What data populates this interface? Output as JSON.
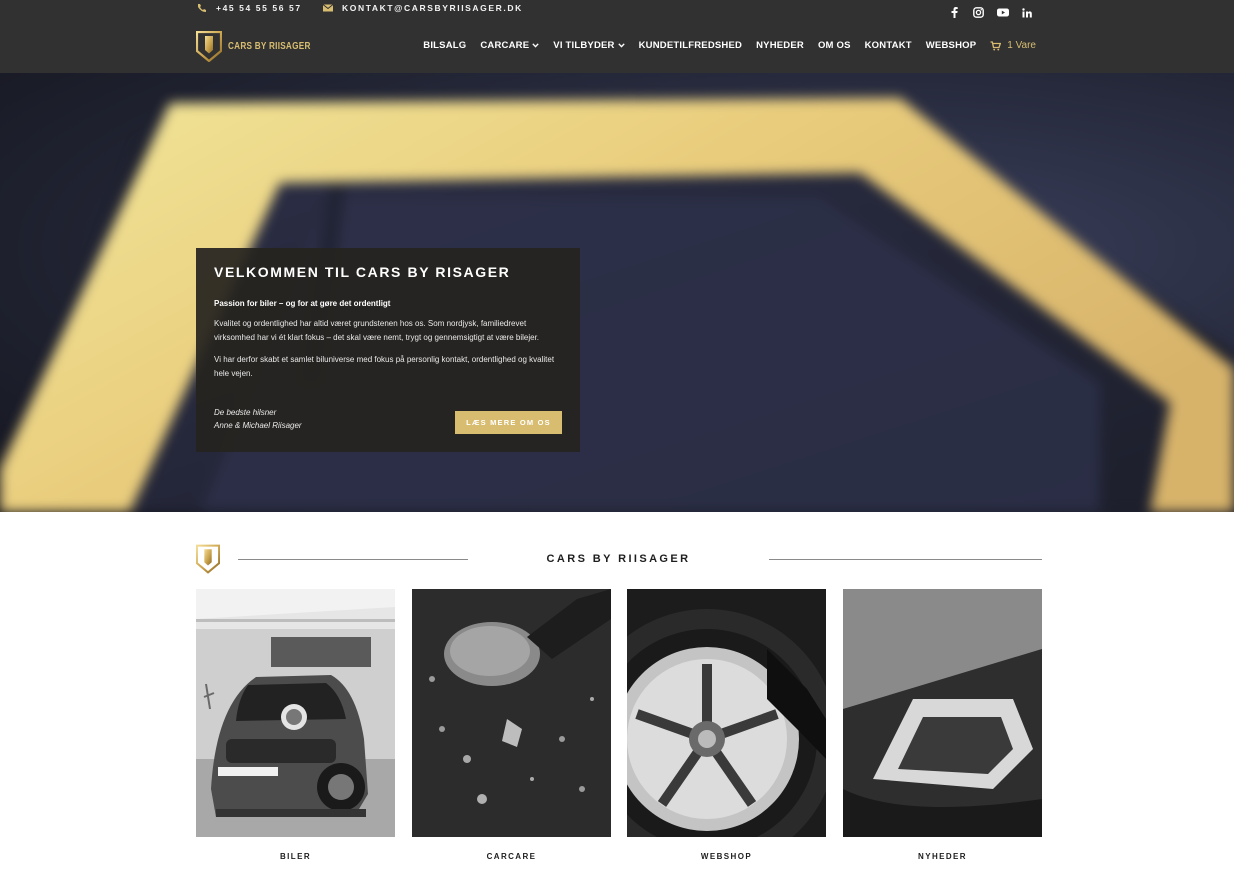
{
  "colors": {
    "accent": "#d8bd71",
    "header_bg": "#313131",
    "card_bg": "#26241f"
  },
  "topbar": {
    "phone": "+45 54 55 56 57",
    "email": "KONTAKT@CARSBYRIISAGER.DK",
    "socials": [
      "facebook-icon",
      "instagram-icon",
      "youtube-icon",
      "linkedin-icon"
    ]
  },
  "logo": {
    "text": "CARS BY RIISAGER"
  },
  "nav": {
    "items": [
      {
        "label": "BILSALG"
      },
      {
        "label": "CARCARE"
      },
      {
        "label": "VI TILBYDER"
      },
      {
        "label": "KUNDETILFREDSHED"
      },
      {
        "label": "NYHEDER"
      },
      {
        "label": "OM OS"
      },
      {
        "label": "KONTAKT"
      },
      {
        "label": "WEBSHOP"
      }
    ],
    "cart": "1 Vare"
  },
  "hero": {
    "title": "VELKOMMEN TIL CARS BY RISAGER",
    "subtitle": "Passion for biler – og for at gøre det ordentligt",
    "p1": "Kvalitet og ordentlighed har altid været grundstenen hos os. Som nordjysk, familiedrevet virksomhed har vi ét klart fokus – det skal være nemt, trygt og gennemsigtigt at være bilejer.",
    "p2": "Vi har derfor skabt et samlet biluniverse med fokus på personlig kontakt, ordentlighed og kvalitet hele vejen.",
    "sign1": "De bedste hilsner",
    "sign2": "Anne & Michael Riisager",
    "button": "LÆS MERE OM OS"
  },
  "section": {
    "title": "CARS BY RIISAGER",
    "tiles": [
      {
        "label": "BILER"
      },
      {
        "label": "CARCARE"
      },
      {
        "label": "WEBSHOP"
      },
      {
        "label": "NYHEDER"
      }
    ]
  }
}
